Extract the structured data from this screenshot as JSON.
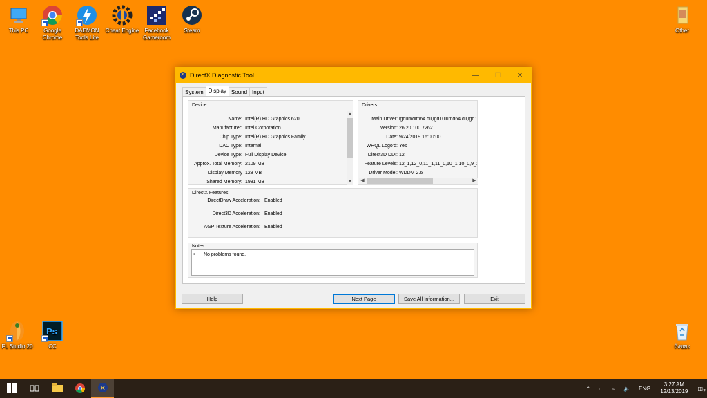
{
  "desktop": {
    "icons_top": [
      {
        "label": "This PC",
        "icon": "computer-icon"
      },
      {
        "label": "Google Chrome",
        "icon": "chrome-icon"
      },
      {
        "label": "DAEMON Tools Lite",
        "icon": "daemon-tools-icon"
      },
      {
        "label": "Cheat Engine",
        "icon": "cheat-engine-icon"
      },
      {
        "label": "Facebook Gameroom",
        "icon": "gameroom-icon"
      },
      {
        "label": "Steam",
        "icon": "steam-icon"
      }
    ],
    "icon_other": {
      "label": "Other",
      "icon": "folder-icon"
    },
    "icons_bottom": [
      {
        "label": "FL Studio 20",
        "icon": "fl-studio-icon"
      },
      {
        "label": "CC",
        "icon": "photoshop-icon"
      }
    ],
    "recycle_bin": {
      "label": "ถังขยะ",
      "icon": "recycle-bin-icon"
    }
  },
  "window": {
    "title": "DirectX Diagnostic Tool",
    "tabs": [
      {
        "label": "System"
      },
      {
        "label": "Display"
      },
      {
        "label": "Sound"
      },
      {
        "label": "Input"
      }
    ],
    "device": {
      "label": "Device",
      "rows": [
        {
          "k": "Name:",
          "v": "Intel(R) HD Graphics 620"
        },
        {
          "k": "Manufacturer:",
          "v": "Intel Corporation"
        },
        {
          "k": "Chip Type:",
          "v": "Intel(R) HD Graphics Family"
        },
        {
          "k": "DAC Type:",
          "v": "Internal"
        },
        {
          "k": "Device Type:",
          "v": "Full Display Device"
        },
        {
          "k": "Approx. Total Memory:",
          "v": "2109 MB"
        },
        {
          "k": "Display Memory",
          "v": "128 MB"
        },
        {
          "k": "Shared Memory:",
          "v": "1981 MB"
        }
      ]
    },
    "drivers": {
      "label": "Drivers",
      "rows": [
        {
          "k": "Main Driver:",
          "v": "igdumdim64.dll,igd10iumd64.dll,igd10"
        },
        {
          "k": "Version:",
          "v": "26.20.100.7262"
        },
        {
          "k": "Date:",
          "v": "9/24/2019 16:00:00"
        },
        {
          "k": "WHQL Logo'd:",
          "v": "Yes"
        },
        {
          "k": "Direct3D DDI:",
          "v": "12"
        },
        {
          "k": "Feature Levels:",
          "v": "12_1,12_0,11_1,11_0,10_1,10_0,9_3"
        },
        {
          "k": "Driver Model:",
          "v": "WDDM 2.6"
        }
      ]
    },
    "features": {
      "label": "DirectX Features",
      "rows": [
        {
          "k": "DirectDraw Acceleration:",
          "v": "Enabled"
        },
        {
          "k": "Direct3D Acceleration:",
          "v": "Enabled"
        },
        {
          "k": "AGP Texture Acceleration:",
          "v": "Enabled"
        }
      ]
    },
    "notes": {
      "label": "Notes",
      "bullet": "•",
      "text": "No problems found."
    },
    "buttons": {
      "help": "Help",
      "next": "Next Page",
      "save": "Save All Information...",
      "exit": "Exit"
    }
  },
  "taskbar": {
    "language": "ENG",
    "time": "3:27 AM",
    "date": "12/13/2019",
    "notification_count": "2"
  },
  "colors": {
    "desktop": "#ff8c00",
    "titlebar": "#ffb900",
    "taskbar": "#2b2016"
  }
}
